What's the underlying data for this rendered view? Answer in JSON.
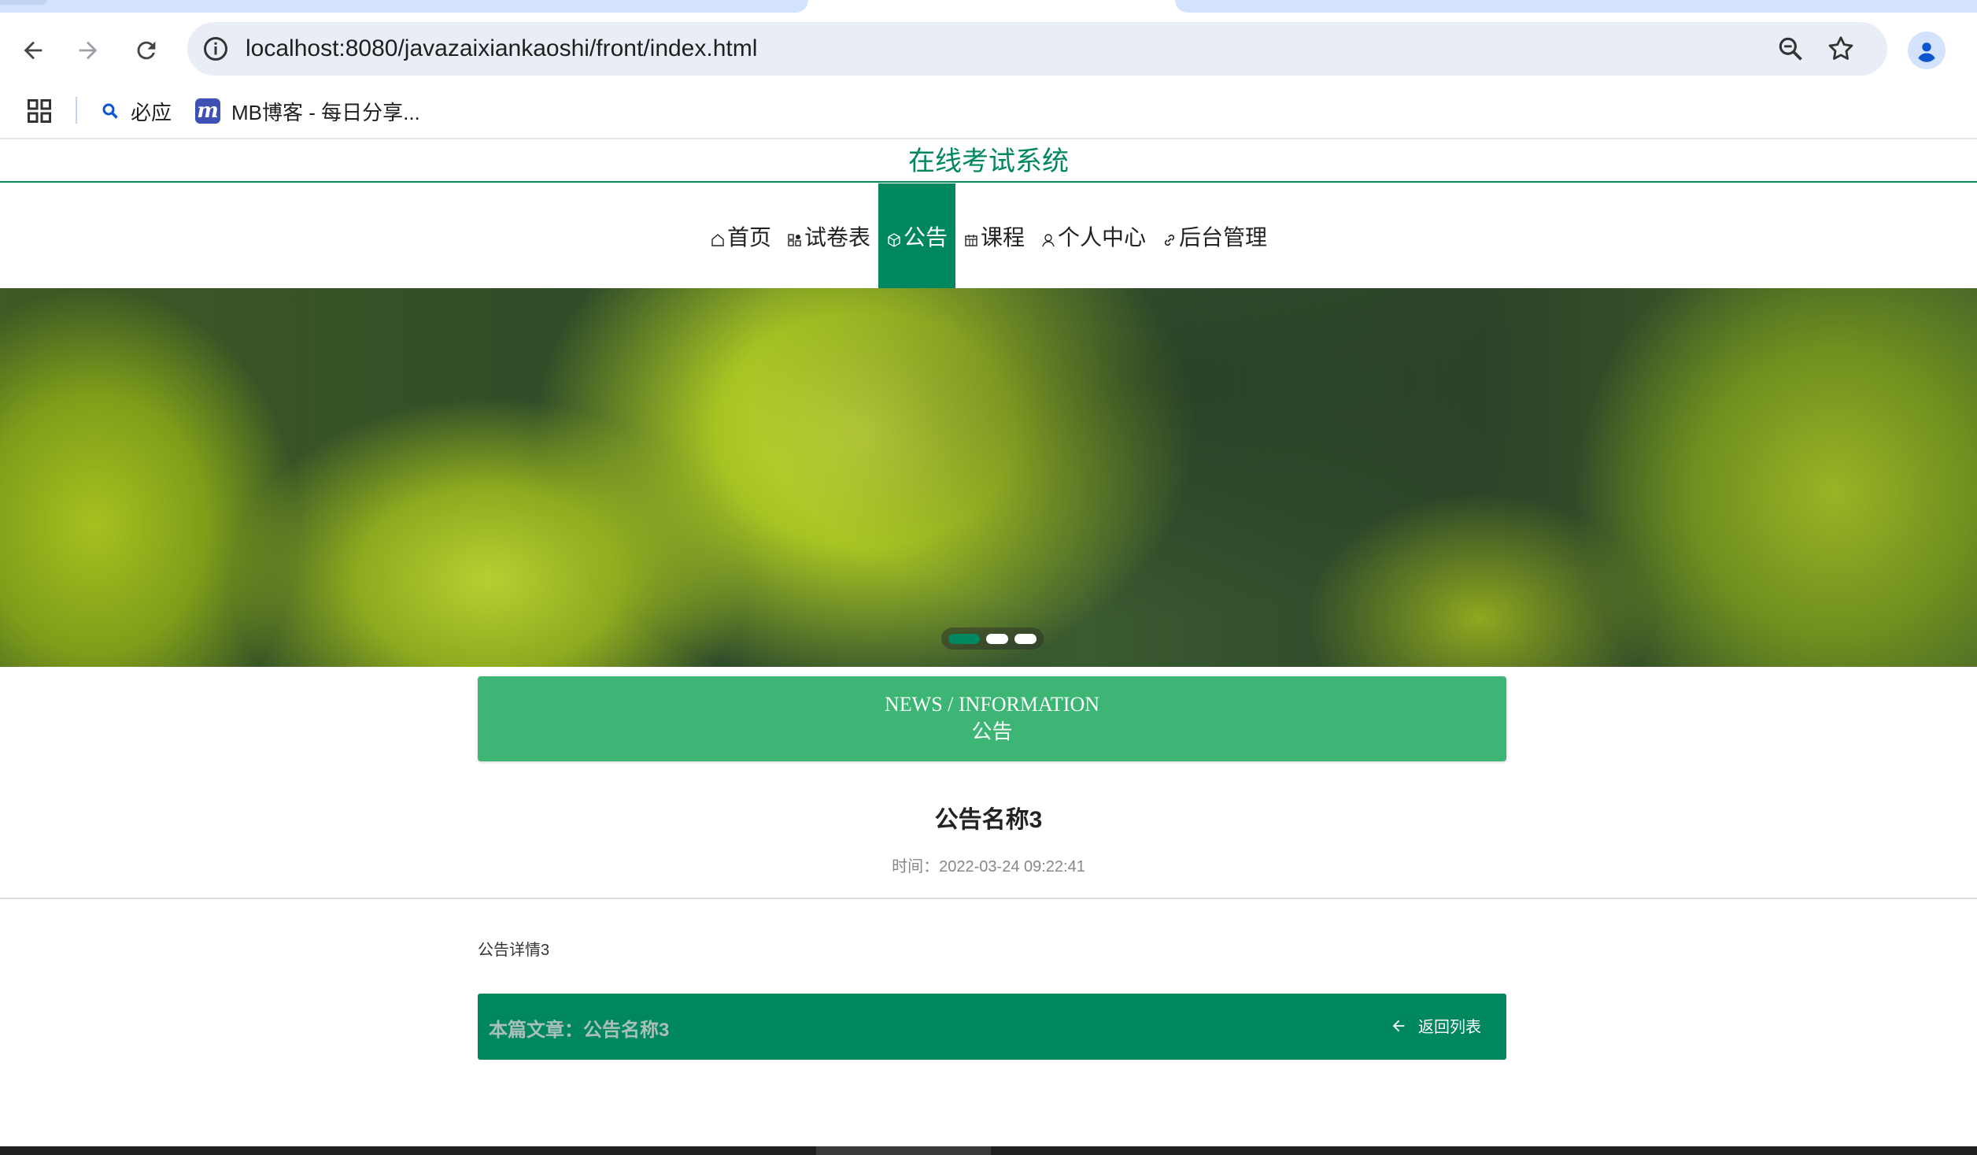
{
  "browser": {
    "url": "localhost:8080/javazaixiankaoshi/front/index.html",
    "bookmarks": [
      {
        "label": "必应",
        "icon": "search-icon"
      },
      {
        "label": "MB博客 - 每日分享...",
        "icon": "mb-logo-icon"
      }
    ]
  },
  "site": {
    "title": "在线考试系统"
  },
  "nav": {
    "items": [
      {
        "label": "首页",
        "icon": "home-icon"
      },
      {
        "label": "试卷表",
        "icon": "grid-icon"
      },
      {
        "label": "公告",
        "icon": "cube-icon",
        "active": true
      },
      {
        "label": "课程",
        "icon": "calendar-icon"
      },
      {
        "label": "个人中心",
        "icon": "user-icon"
      },
      {
        "label": "后台管理",
        "icon": "link-icon"
      }
    ]
  },
  "carousel": {
    "slides": 3,
    "active_index": 0
  },
  "section": {
    "title_en": "NEWS / INFORMATION",
    "title_cn": "公告"
  },
  "article": {
    "title": "公告名称3",
    "time_label": "时间：",
    "time_value": "2022-03-24 09:22:41",
    "content": "公告详情3"
  },
  "footer": {
    "current_label": "本篇文章：",
    "current_title": "公告名称3",
    "back_label": "返回列表"
  },
  "colors": {
    "primary": "#00875f",
    "section_head": "#3db575"
  }
}
